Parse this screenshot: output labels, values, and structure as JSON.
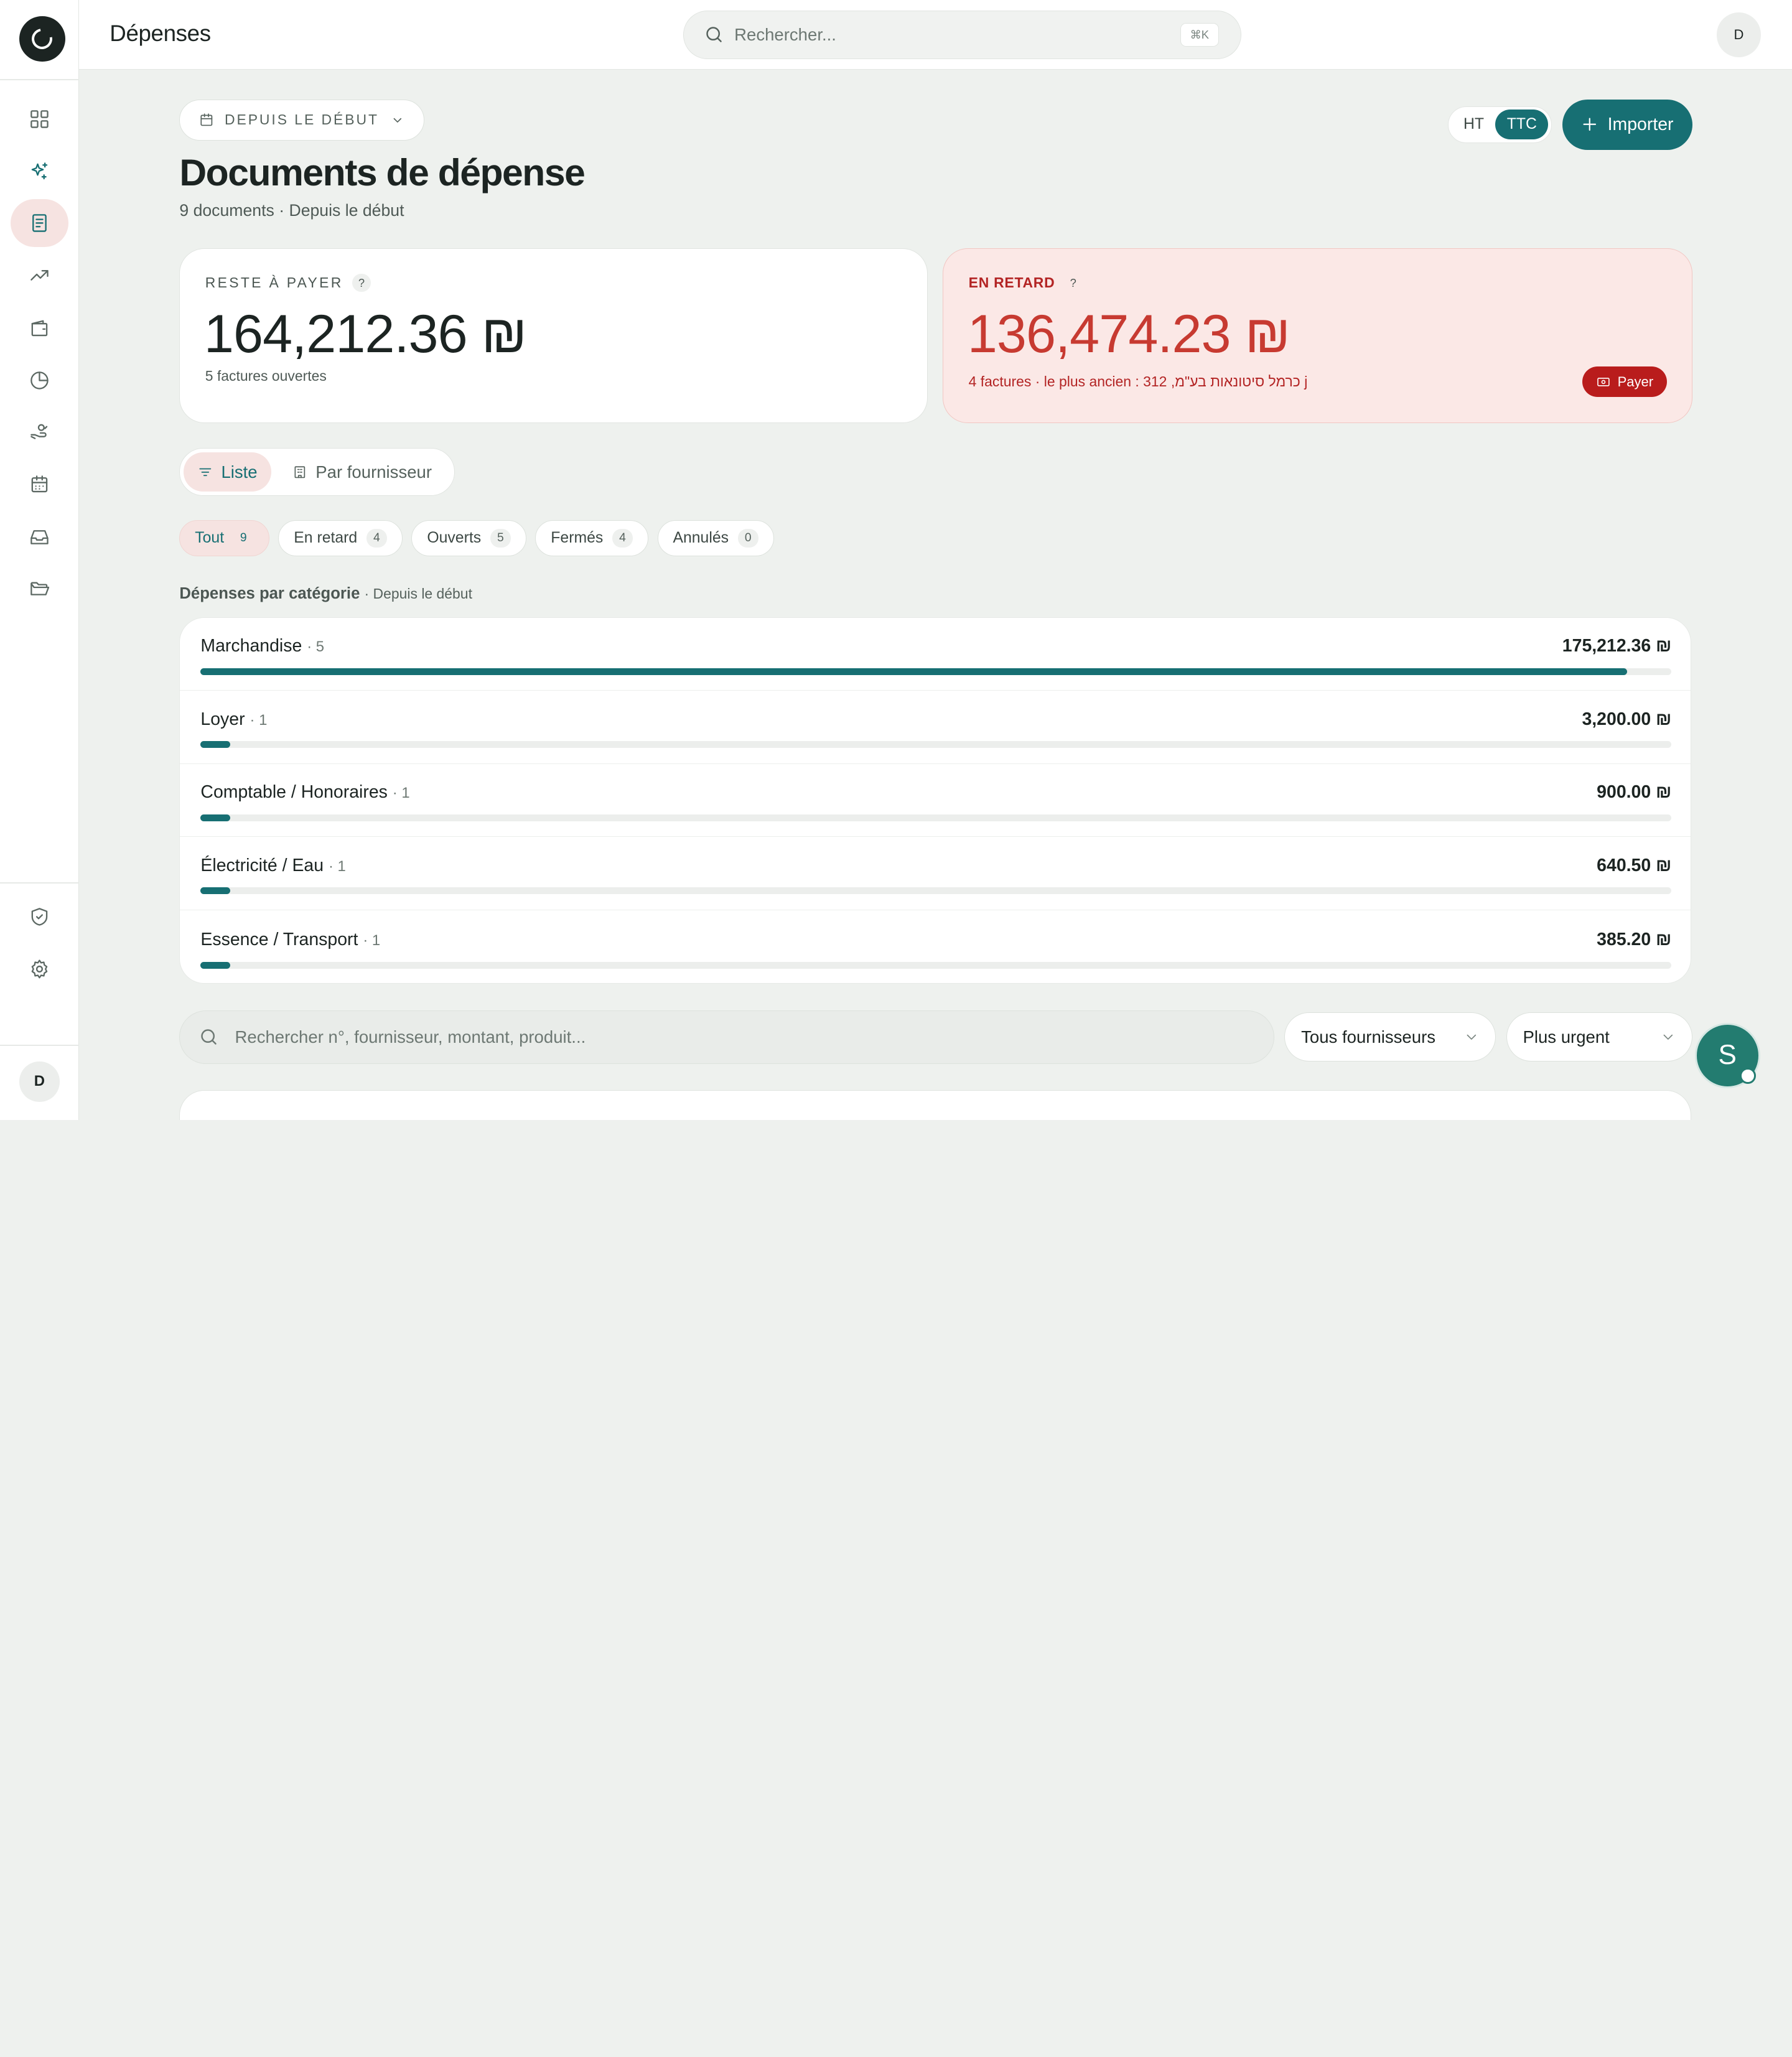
{
  "app": {
    "page_name": "Dépenses"
  },
  "search": {
    "placeholder": "Rechercher...",
    "shortcut": "⌘K"
  },
  "user": {
    "initial": "D"
  },
  "sidebar": {
    "items": [
      {
        "icon": "grid-icon"
      },
      {
        "icon": "sparkles-icon"
      },
      {
        "icon": "receipt-icon",
        "active": true
      },
      {
        "icon": "trending-up-icon"
      },
      {
        "icon": "wallet-icon"
      },
      {
        "icon": "pie-chart-icon"
      },
      {
        "icon": "hand-coins-icon"
      },
      {
        "icon": "calendar-icon"
      },
      {
        "icon": "inbox-icon"
      },
      {
        "icon": "folder-open-icon"
      }
    ],
    "bottom": [
      {
        "icon": "shield-check-icon"
      },
      {
        "icon": "gear-icon"
      }
    ]
  },
  "header": {
    "period": "DEPUIS LE DÉBUT",
    "title": "Documents de dépense",
    "subtitle": "9 documents · Depuis le début",
    "toggle": {
      "ht": "HT",
      "ttc": "TTC",
      "selected": "TTC"
    },
    "import_label": "Importer"
  },
  "kpi": {
    "due": {
      "label": "RESTE À PAYER",
      "help": "?",
      "value": "164,212.36 ₪",
      "sub": "5 factures ouvertes"
    },
    "overdue": {
      "label": "EN RETARD",
      "help": "?",
      "value": "136,474.23 ₪",
      "sub": "4 factures · le plus ancien : כרמל סיטונאות בע\"מ, 312 j",
      "pay_label": "Payer"
    }
  },
  "view": {
    "list": "Liste",
    "by_supplier": "Par fournisseur",
    "selected": "Liste"
  },
  "filters": [
    {
      "label": "Tout",
      "count": "9",
      "active": true
    },
    {
      "label": "En retard",
      "count": "4"
    },
    {
      "label": "Ouverts",
      "count": "5"
    },
    {
      "label": "Fermés",
      "count": "4"
    },
    {
      "label": "Annulés",
      "count": "0"
    }
  ],
  "categories": {
    "title": "Dépenses par catégorie",
    "period": "· Depuis le début",
    "rows": [
      {
        "name": "Marchandise",
        "count": "· 5",
        "amount": "175,212.36 ₪",
        "share": 0.97
      },
      {
        "name": "Loyer",
        "count": "· 1",
        "amount": "3,200.00 ₪",
        "share": 0.02
      },
      {
        "name": "Comptable / Honoraires",
        "count": "· 1",
        "amount": "900.00 ₪",
        "share": 0.02
      },
      {
        "name": "Électricité / Eau",
        "count": "· 1",
        "amount": "640.50 ₪",
        "share": 0.02
      },
      {
        "name": "Essence / Transport",
        "count": "· 1",
        "amount": "385.20 ₪",
        "share": 0.02
      }
    ]
  },
  "list_controls": {
    "search_placeholder": "Rechercher n°, fournisseur, montant, produit...",
    "supplier_select": "Tous fournisseurs",
    "sort_select": "Plus urgent"
  },
  "assistant": {
    "initial": "S"
  },
  "colors": {
    "accent": "#176f73",
    "danger": "#b91c1c",
    "overdue_bg": "#fbe8e6"
  }
}
